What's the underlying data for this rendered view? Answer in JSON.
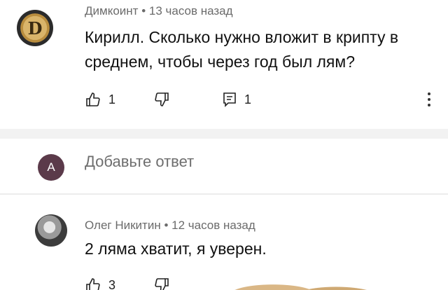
{
  "comment1": {
    "author": "Димкоинт",
    "time": "13 часов назад",
    "text": "Кирилл. Сколько нужно вложит в крипту в среднем, чтобы через год был лям?",
    "likes": "1",
    "replies": "1",
    "avatar_letter": "D"
  },
  "reply_box": {
    "avatar_letter": "А",
    "placeholder": "Добавьте ответ"
  },
  "comment2": {
    "author": "Олег Никитин",
    "time": "12 часов назад",
    "text": "2 ляма хватит, я уверен.",
    "likes": "3"
  },
  "separator": "•"
}
